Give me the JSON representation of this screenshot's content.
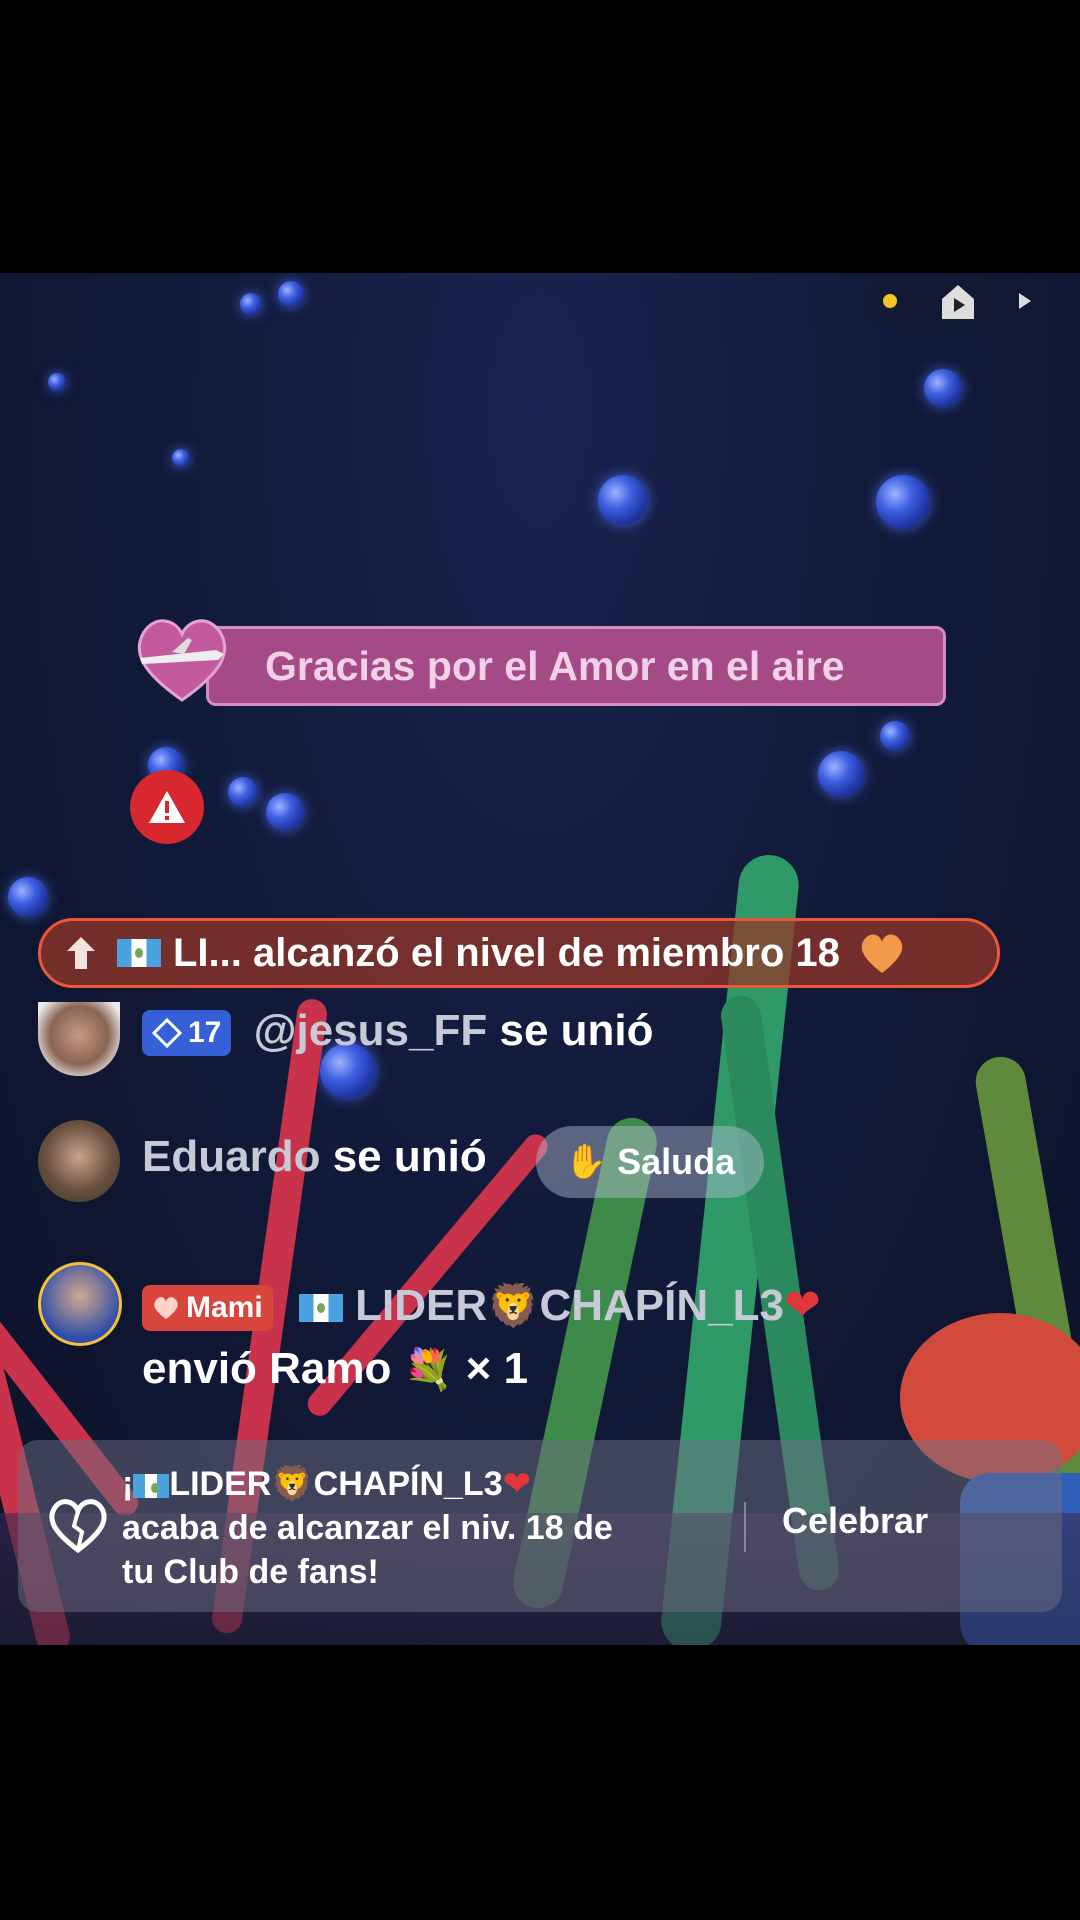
{
  "banner": {
    "text": "Gracias por el Amor en el aire"
  },
  "level_notice": {
    "text": "LI... alcanzó el nivel de miembro 18"
  },
  "join1": {
    "level": "17",
    "user": "@jesus_FF",
    "action": "se unió"
  },
  "join2": {
    "user": "Eduardo",
    "action": "se unió",
    "wave_button": "Saluda"
  },
  "gift": {
    "badge": "Mami",
    "user": "LIDER",
    "user_suffix": "CHAPÍN_L3",
    "message_prefix": "envió Ramo",
    "message_suffix": "× 1"
  },
  "fanclub": {
    "line1_prefix": "¡",
    "line1_user": "LIDER",
    "line1_suffix": "CHAPÍN_L3",
    "line2": "acaba de alcanzar el niv. 18 de",
    "line3": "tu Club de fans!",
    "celebrate_button": "Celebrar"
  },
  "colors": {
    "banner": "#a44a87",
    "warning": "#d7282f",
    "level_pill": "#ea5838",
    "status_dot": "#f3c623"
  }
}
